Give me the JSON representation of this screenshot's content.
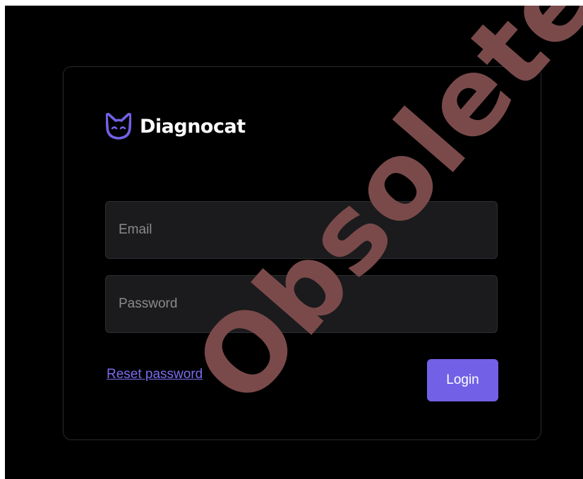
{
  "brand": {
    "name": "Diagnocat",
    "logo_color": "#7261e6",
    "logo_icon": "cat-face-icon"
  },
  "form": {
    "email_placeholder": "Email",
    "password_placeholder": "Password",
    "reset_label": "Reset password",
    "login_label": "Login"
  },
  "watermark": {
    "text": "Obsolete",
    "color": "#7a4a4a"
  },
  "colors": {
    "background": "#000000",
    "accent": "#7261e6",
    "link": "#7b6cf0"
  }
}
